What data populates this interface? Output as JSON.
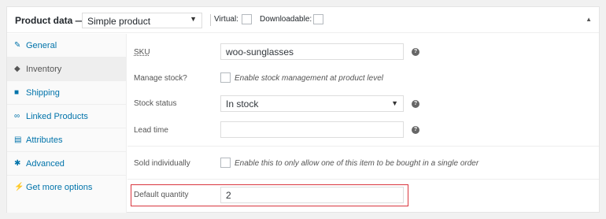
{
  "header": {
    "title": "Product data —",
    "product_type": "Simple product",
    "virtual_label": "Virtual:",
    "downloadable_label": "Downloadable:"
  },
  "sidebar": {
    "items": [
      {
        "label": "General",
        "icon": "wrench-icon"
      },
      {
        "label": "Inventory",
        "icon": "tag-icon"
      },
      {
        "label": "Shipping",
        "icon": "truck-icon"
      },
      {
        "label": "Linked Products",
        "icon": "link-icon"
      },
      {
        "label": "Attributes",
        "icon": "list-icon"
      },
      {
        "label": "Advanced",
        "icon": "gear-icon"
      },
      {
        "label": "Get more options",
        "icon": "plugin-icon"
      }
    ],
    "active": "Inventory"
  },
  "inventory": {
    "sku_label": "SKU",
    "sku_value": "woo-sunglasses",
    "manage_stock_label": "Manage stock?",
    "manage_stock_text": "Enable stock management at product level",
    "stock_status_label": "Stock status",
    "stock_status_value": "In stock",
    "lead_time_label": "Lead time",
    "lead_time_value": "",
    "sold_individually_label": "Sold individually",
    "sold_individually_text": "Enable this to only allow one of this item to be bought in a single order",
    "default_quantity_label": "Default quantity",
    "default_quantity_value": "2"
  },
  "colors": {
    "link": "#0073aa",
    "highlight": "#d9363e"
  }
}
